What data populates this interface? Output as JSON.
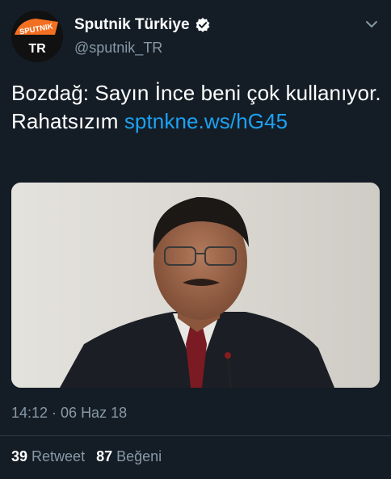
{
  "account": {
    "name": "Sputnik Türkiye",
    "handle": "@sputnik_TR",
    "avatar_text_top": "SPUTNIK",
    "avatar_text_bottom": "TR",
    "brand_color": "#f36f21"
  },
  "tweet": {
    "text": "Bozdağ: Sayın İnce beni çok kullanıyor. Rahatsızım ",
    "link": "sptnkne.ws/hG45",
    "link_color": "#1da1f2"
  },
  "meta": {
    "timestamp": "14:12 · 06 Haz 18"
  },
  "stats": {
    "retweets_count": "39",
    "retweets_label": "Retweet",
    "likes_count": "87",
    "likes_label": "Beğeni"
  },
  "icons": {
    "verified": "verified-badge-icon",
    "menu": "chevron-down-icon"
  },
  "colors": {
    "background": "#141d26",
    "secondary_text": "#8899a6"
  }
}
